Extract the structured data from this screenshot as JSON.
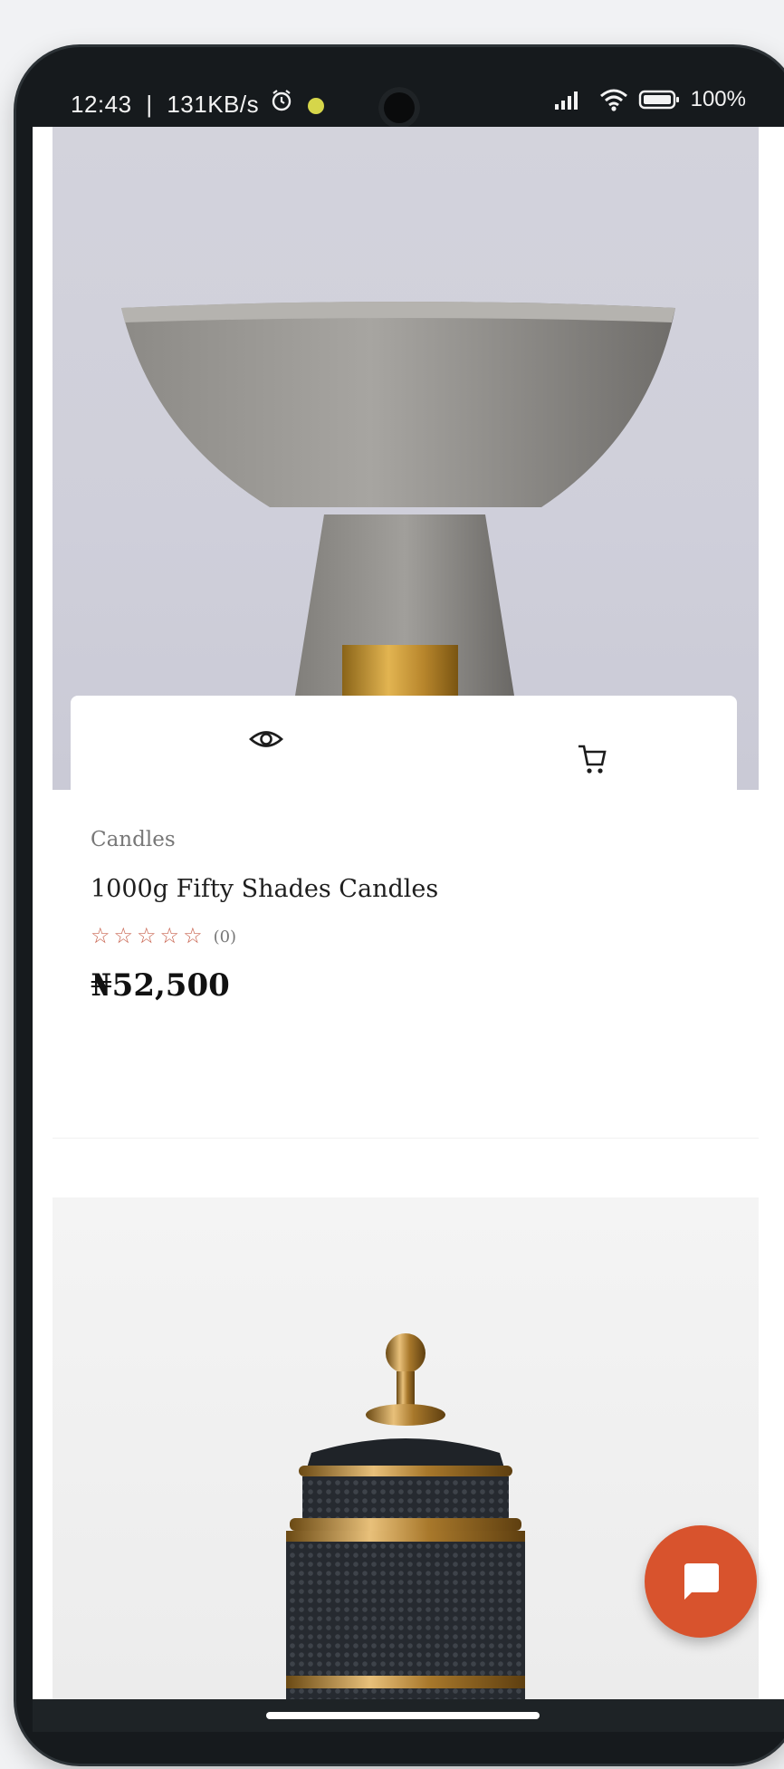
{
  "status_bar": {
    "time": "12:43",
    "separator": "|",
    "network_speed": "131KB/s",
    "battery_level": "100%",
    "icons": [
      "alarm-icon",
      "notification-dot-icon",
      "signal-icon",
      "wifi-icon",
      "battery-icon"
    ]
  },
  "product": {
    "category": "Candles",
    "name": "1000g Fifty Shades Candles",
    "rating": {
      "stars_filled": 0,
      "stars_total": 5,
      "count_label": "(0)"
    },
    "price": "₦52,500",
    "actions": [
      "eye-icon",
      "cart-icon"
    ]
  },
  "fab": {
    "icon": "chat-icon",
    "color": "#d8532d"
  },
  "colors": {
    "star": "#c96450",
    "accent": "#d8532d"
  }
}
